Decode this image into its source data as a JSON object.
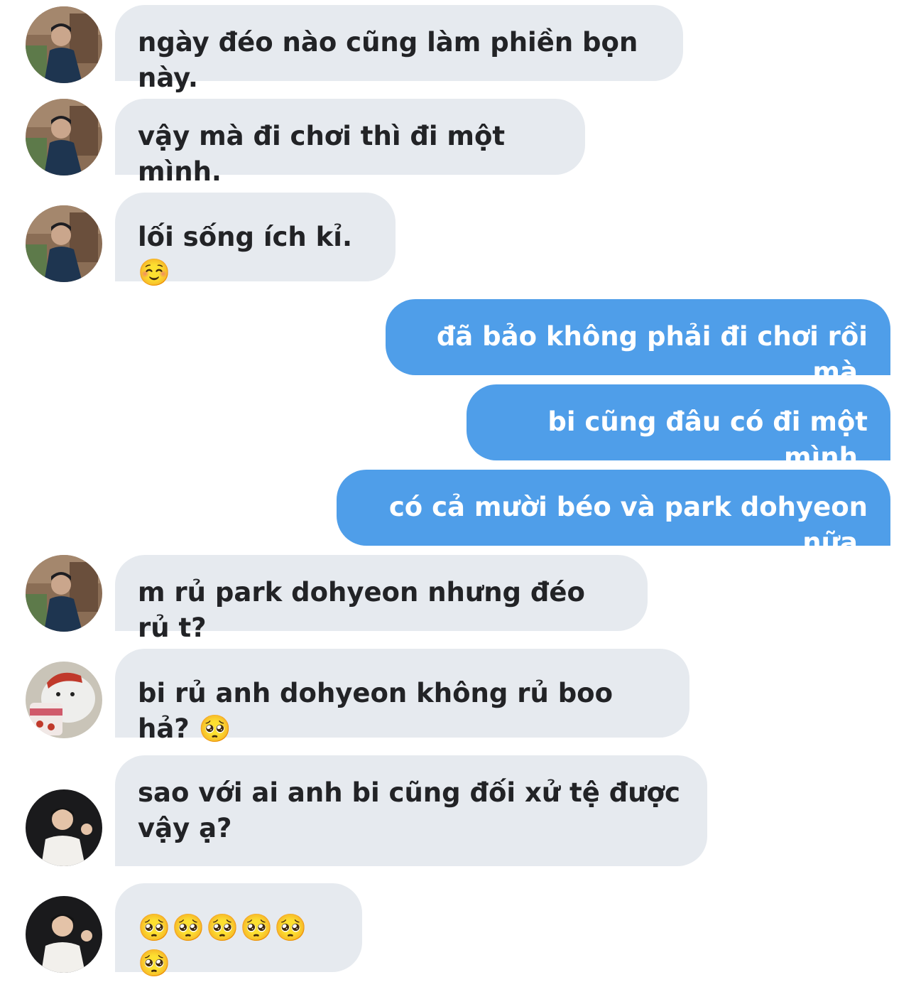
{
  "colors": {
    "incoming_bubble": "#e6eaef",
    "outgoing_bubble": "#4f9ee9",
    "incoming_text": "#222326",
    "outgoing_text": "#ffffff"
  },
  "messages": [
    {
      "direction": "in",
      "avatar": "man-in-dark-coat-photo",
      "text": "ngày đéo nào cũng làm phiền bọn này."
    },
    {
      "direction": "in",
      "avatar": "man-in-dark-coat-photo",
      "text": "vậy mà đi chơi thì đi một mình."
    },
    {
      "direction": "in",
      "avatar": "man-in-dark-coat-photo",
      "text": "lối sống ích kỉ. ☺️"
    },
    {
      "direction": "out",
      "text": "đã bảo không phải đi chơi rồi mà."
    },
    {
      "direction": "out",
      "text": "bi cũng đâu có đi một mình."
    },
    {
      "direction": "out",
      "text": "có cả mười béo và park dohyeon nữa."
    },
    {
      "direction": "in",
      "avatar": "man-in-dark-coat-photo",
      "text": "m rủ park dohyeon nhưng đéo rủ t?"
    },
    {
      "direction": "in",
      "avatar": "bear-with-ice-cream-illustration",
      "text": "bi rủ anh dohyeon không rủ boo hả? 🥺"
    },
    {
      "direction": "in",
      "avatar": "man-waving-white-shirt-photo",
      "text": "sao với ai anh bi cũng đối xử tệ được\nvậy ạ?"
    },
    {
      "direction": "in",
      "avatar": "man-waving-white-shirt-photo",
      "text": "🥺🥺🥺🥺🥺🥺"
    }
  ]
}
